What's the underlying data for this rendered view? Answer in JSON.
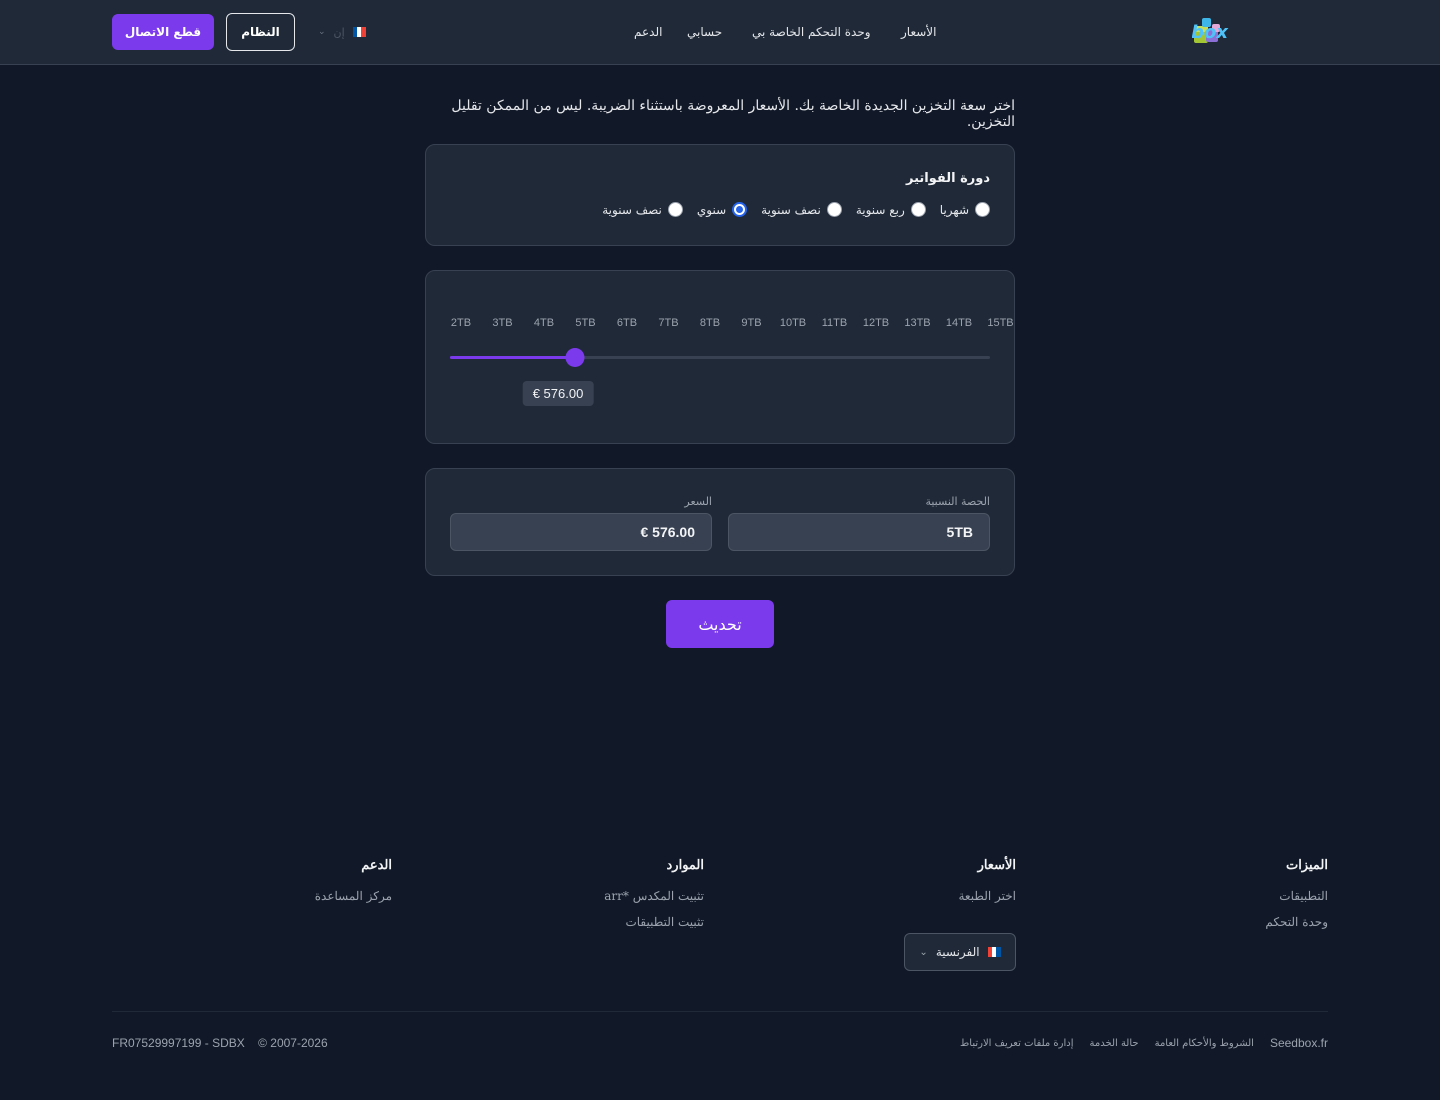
{
  "header": {
    "brand": "Seedbox",
    "nav": [
      {
        "label": "الأسعار"
      },
      {
        "label": "وحدة التحكم الخاصة بي"
      },
      {
        "label": "حسابي"
      },
      {
        "label": "الدعم"
      }
    ],
    "language_code": "إن",
    "system_label": "النظام",
    "disconnect_label": "قطع الاتصال"
  },
  "intro_text": "اختر سعة التخزين الجديدة الخاصة بك. الأسعار المعروضة باستثناء الضريبة. ليس من الممكن تقليل التخزين.",
  "billing": {
    "title": "دورة الفواتير",
    "options": [
      {
        "label": "شهريا",
        "checked": false
      },
      {
        "label": "ربع سنوية",
        "checked": false
      },
      {
        "label": "نصف سنوية",
        "checked": false
      },
      {
        "label": "سنوي",
        "checked": true
      },
      {
        "label": "نصف سنوية",
        "checked": false
      }
    ]
  },
  "storage_slider": {
    "ticks": [
      "2TB",
      "3TB",
      "4TB",
      "5TB",
      "6TB",
      "7TB",
      "8TB",
      "9TB",
      "10TB",
      "11TB",
      "12TB",
      "13TB",
      "14TB",
      "15TB"
    ],
    "selected": "5TB",
    "price": "€ 576.00"
  },
  "summary": {
    "quota_label": "الحصة النسبية",
    "quota_value": "5TB",
    "price_label": "السعر",
    "price_value": "€ 576.00"
  },
  "update_label": "تحديث",
  "footer": {
    "columns": [
      {
        "title": "الميزات",
        "links": [
          "التطبيقات",
          "وحدة التحكم"
        ]
      },
      {
        "title": "الأسعار",
        "links": [
          "اختر الطبعة"
        ]
      },
      {
        "title": "الموارد",
        "links": [
          "تثبيت المكدس *arr",
          "تثبيت التطبيقات"
        ]
      },
      {
        "title": "الدعم",
        "links": [
          "مركز المساعدة"
        ]
      }
    ],
    "language_select": "الفرنسية",
    "bottom_links": [
      "Seedbox.fr",
      "الشروط والأحكام العامة",
      "حالة الخدمة",
      "إدارة ملفات تعريف الارتباط"
    ],
    "copyright": "© 2007-2026",
    "company_id": "FR07529997199 - SDBX"
  },
  "colors": {
    "accent": "#7c3aed",
    "background": "#111827",
    "surface": "#1f2937"
  }
}
